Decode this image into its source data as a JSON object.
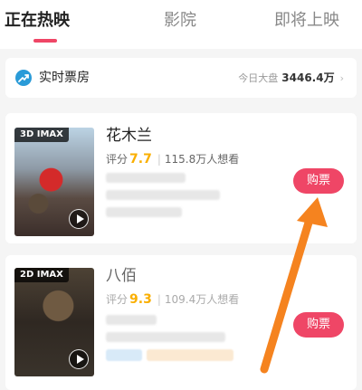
{
  "tabs": [
    {
      "label": "正在热映"
    },
    {
      "label": "影院"
    },
    {
      "label": "即将上映"
    }
  ],
  "box_office": {
    "title": "实时票房",
    "today_label": "今日大盘",
    "today_value": "3446.4万",
    "icon": "trend-icon"
  },
  "movies": [
    {
      "badge": "3D IMAX",
      "title": "花木兰",
      "rating_label": "评分",
      "score": "7.7",
      "wants": "115.8万人想看",
      "buy_label": "购票"
    },
    {
      "badge": "2D IMAX",
      "title": "八佰",
      "rating_label": "评分",
      "score": "9.3",
      "wants": "109.4万人想看",
      "buy_label": "购票"
    }
  ],
  "colors": {
    "accent": "#ef4666",
    "score": "#faaf00",
    "annotation_arrow": "#f5831f"
  }
}
